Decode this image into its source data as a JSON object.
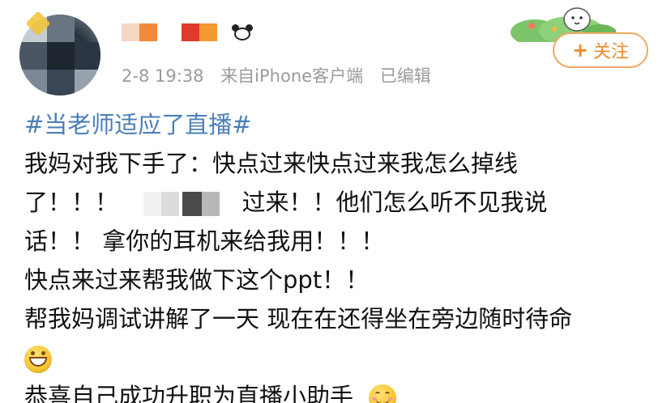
{
  "post": {
    "meta": {
      "time": "2-8 19:38",
      "source": "来自iPhone客户端",
      "edited": "已编辑"
    },
    "follow": {
      "plus": "+",
      "label": "关注"
    },
    "content": {
      "hashtag": "#当老师适应了直播#",
      "line1": "我妈对我下手了：快点过来快点过来我怎么掉线",
      "line2_a": "了！！！",
      "line2_b": "过来！！他们怎么听不见我说",
      "line3": "话！！ 拿你的耳机来给我用！！！",
      "line4": "快点来过来帮我做下这个ppt！！",
      "line5": "帮我妈调试讲解了一天 现在在还得坐在旁边随时待命",
      "line7": "恭喜自己成功升职为直播小助手"
    },
    "emojis": [
      "grin-emoji",
      "smile-emoji"
    ],
    "colors": {
      "hashtag": "#4c7fb8",
      "follow": "#f08a2e",
      "meta": "#9a9a9a",
      "text": "#111111"
    }
  }
}
